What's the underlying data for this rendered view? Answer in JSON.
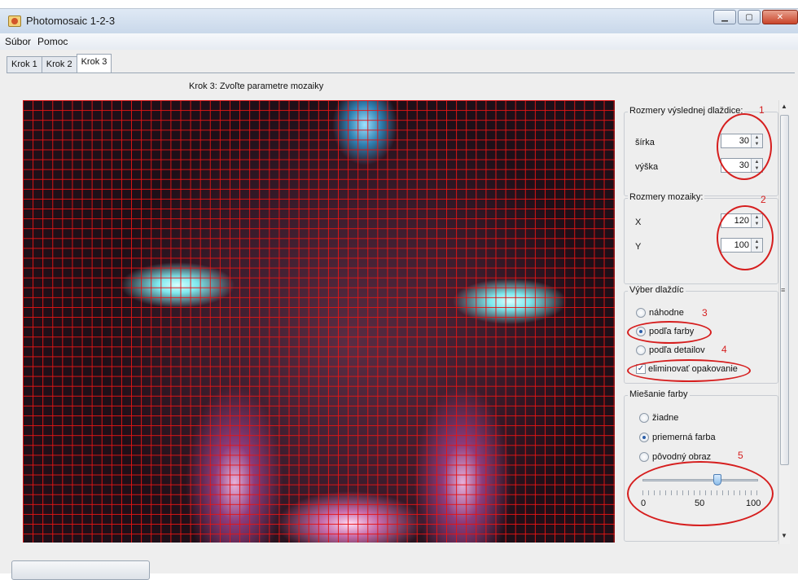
{
  "window": {
    "title": "Photomosaic 1-2-3"
  },
  "menu": [
    "Súbor",
    "Pomoc"
  ],
  "tabs": [
    "Krok 1",
    "Krok 2",
    "Krok 3"
  ],
  "active_tab": "Krok 3",
  "step_title": "Krok 3: Zvoľte parametre mozaiky",
  "tile_size": {
    "title": "Rozmery výslednej dlaždice:",
    "width_label": "šírka",
    "width_value": "30",
    "height_label": "výška",
    "height_value": "30",
    "annotation": "1"
  },
  "mosaic_size": {
    "title": "Rozmery mozaiky:",
    "x_label": "X",
    "x_value": "120",
    "y_label": "Y",
    "y_value": "100",
    "annotation": "2"
  },
  "tile_selection": {
    "title": "Výber dlaždíc",
    "options": [
      "náhodne",
      "podľa farby",
      "podľa detailov"
    ],
    "selected": "podľa farby",
    "eliminate_label": "eliminovať opakovanie",
    "eliminate_checked": true,
    "annotation_a": "3",
    "annotation_b": "4"
  },
  "color_mix": {
    "title": "Miešanie farby",
    "options": [
      "žiadne",
      "priemerná farba",
      "pôvodný obraz"
    ],
    "selected": "priemerná farba",
    "slider_min": "0",
    "slider_mid": "50",
    "slider_max": "100",
    "slider_value": 65,
    "annotation": "5"
  },
  "colors": {
    "annotation_red": "#d61e1e",
    "grid_red": "#e61414",
    "accent_blue": "#2a5da8"
  }
}
